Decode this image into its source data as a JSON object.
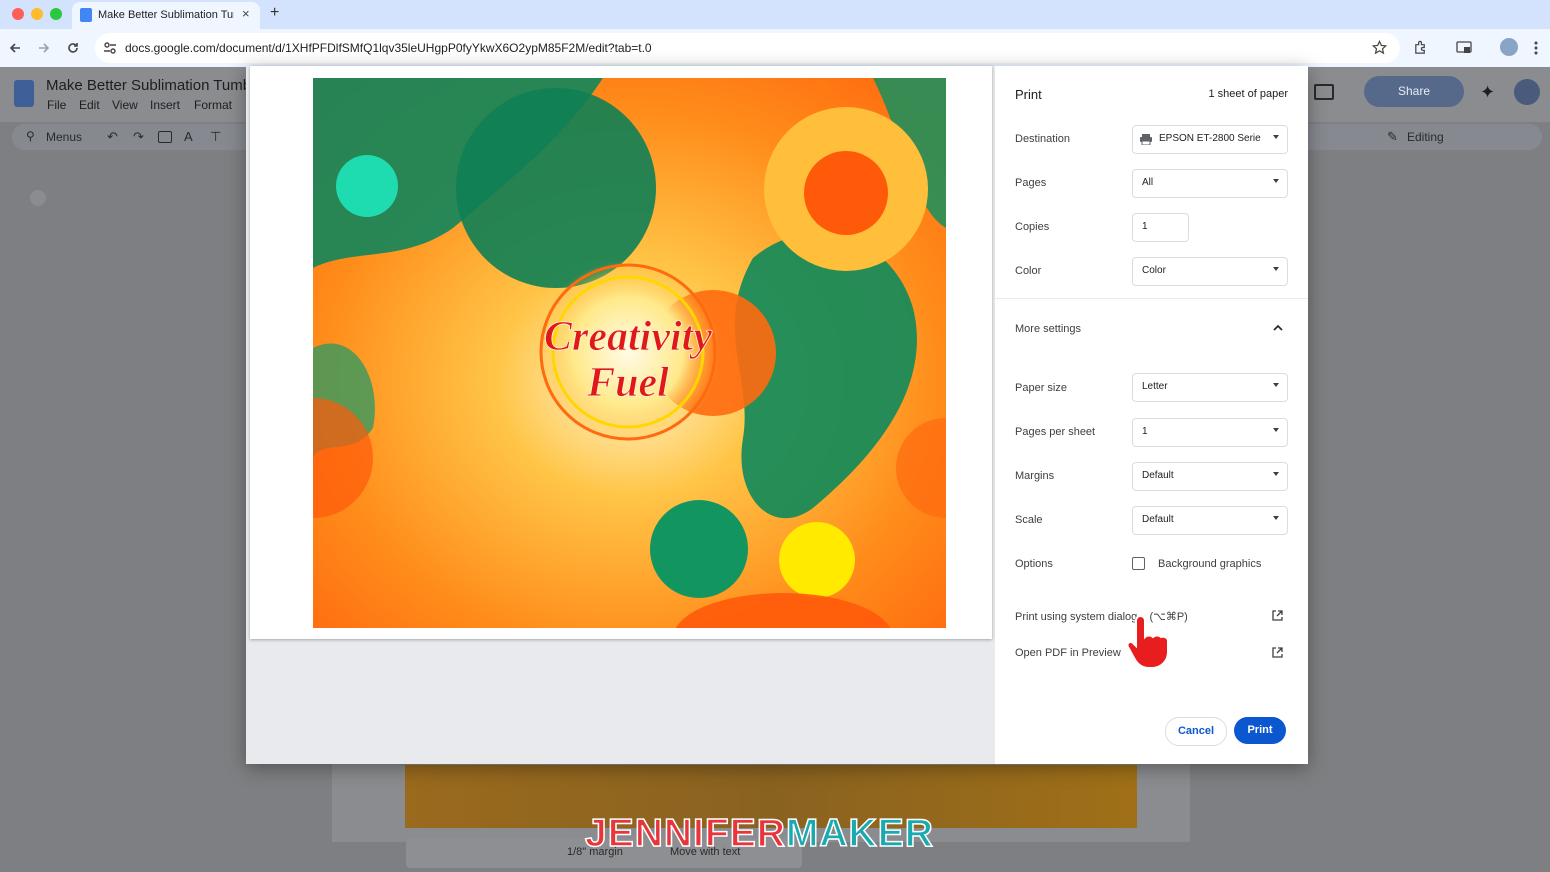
{
  "browser": {
    "tab_title": "Make Better Sublimation Tum",
    "tab_close": "×",
    "new_tab": "+",
    "url": "docs.google.com/document/d/1XHfPFDlfSMfQ1lqv35leUHgpP0fyYkwX6O2ypM85F2M/edit?tab=t.0"
  },
  "docs": {
    "title": "Make Better Sublimation Tumb",
    "menus": [
      "File",
      "Edit",
      "View",
      "Insert",
      "Format"
    ],
    "toolbar_menus_label": "Menus",
    "share_label": "Share",
    "editing_label": "Editing",
    "image_toolbar": {
      "page_label": "1/8\" margin",
      "wrap_label": "Move with text"
    }
  },
  "print_dialog": {
    "title": "Print",
    "sheet_count": "1 sheet of paper",
    "destination": {
      "label": "Destination",
      "value": "EPSON ET-2800 Serie"
    },
    "pages": {
      "label": "Pages",
      "value": "All"
    },
    "copies": {
      "label": "Copies",
      "value": "1"
    },
    "color": {
      "label": "Color",
      "value": "Color"
    },
    "more_settings": "More settings",
    "paper_size": {
      "label": "Paper size",
      "value": "Letter"
    },
    "pages_per_sheet": {
      "label": "Pages per sheet",
      "value": "1"
    },
    "margins": {
      "label": "Margins",
      "value": "Default"
    },
    "scale": {
      "label": "Scale",
      "value": "Default"
    },
    "options": {
      "label": "Options",
      "checkbox_label": "Background graphics",
      "checked": false
    },
    "system_dialog": "Print using system dialog... (⌥⌘P)",
    "open_pdf": "Open PDF in Preview",
    "cancel": "Cancel",
    "print": "Print",
    "accent_color": "#0b57d0"
  },
  "preview_art": {
    "line1": "Creativity",
    "line2": "Fuel"
  },
  "watermark": {
    "part1": "JENNIFER",
    "part2": "MAKER"
  }
}
